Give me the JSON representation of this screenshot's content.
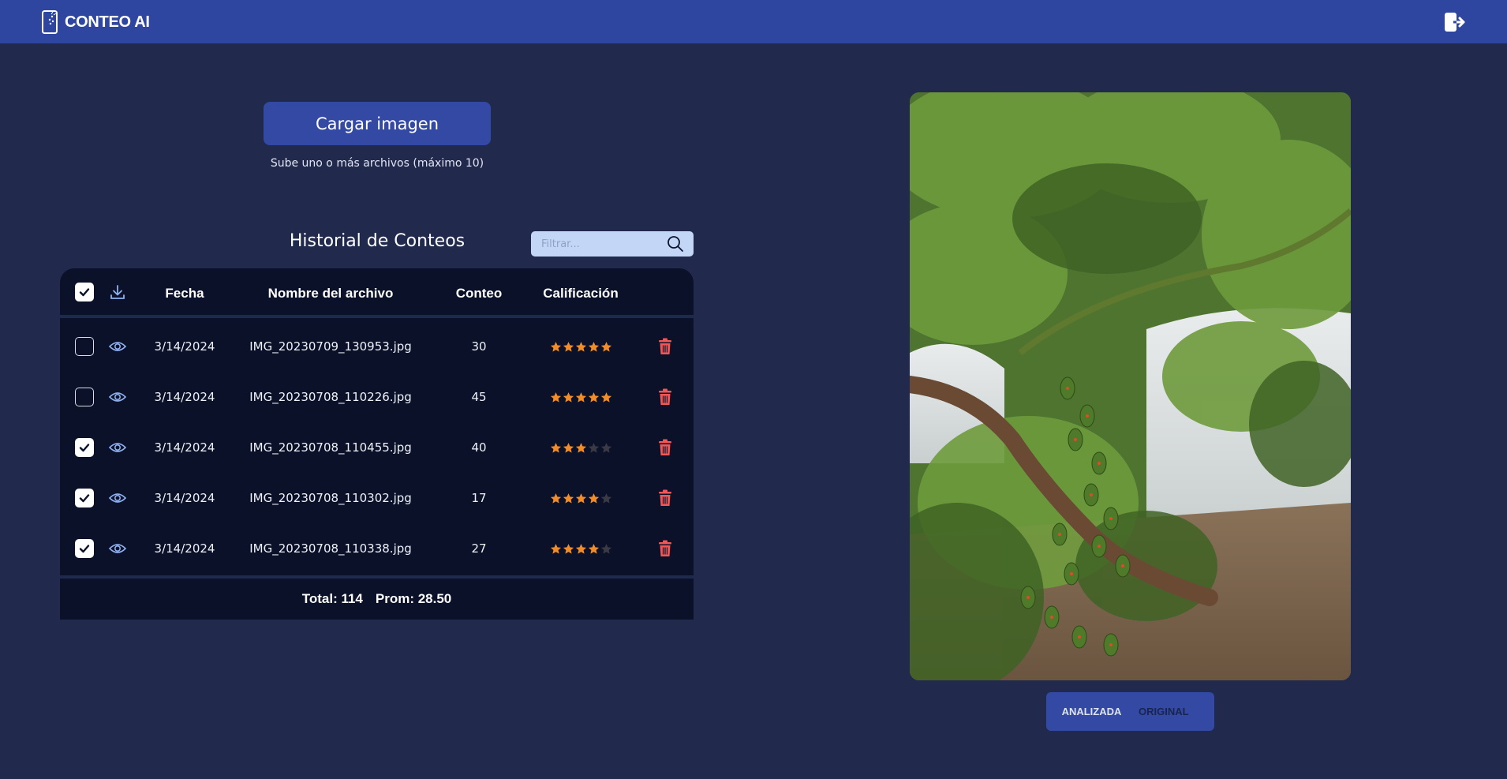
{
  "app": {
    "brand": "CONTEO AI"
  },
  "upload": {
    "button_label": "Cargar imagen",
    "hint": "Sube uno o más archivos (máximo 10)"
  },
  "history": {
    "title": "Historial de Conteos",
    "filter_placeholder": "Filtrar...",
    "columns": {
      "date": "Fecha",
      "filename": "Nombre del archivo",
      "count": "Conteo",
      "rating": "Calificación"
    },
    "select_all_checked": true,
    "rows": [
      {
        "checked": false,
        "date": "3/14/2024",
        "filename": "IMG_20230709_130953.jpg",
        "count": "30",
        "rating": 5
      },
      {
        "checked": false,
        "date": "3/14/2024",
        "filename": "IMG_20230708_110226.jpg",
        "count": "45",
        "rating": 5
      },
      {
        "checked": true,
        "date": "3/14/2024",
        "filename": "IMG_20230708_110455.jpg",
        "count": "40",
        "rating": 3
      },
      {
        "checked": true,
        "date": "3/14/2024",
        "filename": "IMG_20230708_110302.jpg",
        "count": "17",
        "rating": 4
      },
      {
        "checked": true,
        "date": "3/14/2024",
        "filename": "IMG_20230708_110338.jpg",
        "count": "27",
        "rating": 4
      }
    ],
    "footer": {
      "total": "Total: 114",
      "average": "Prom: 28.50"
    }
  },
  "viewer": {
    "tabs": {
      "analyzed": "ANALIZADA",
      "original": "ORIGINAL"
    },
    "active_tab": "analyzed"
  },
  "colors": {
    "topbar": "#2e46a0",
    "background": "#212a4d",
    "table": "#0a1129",
    "star_on": "#f28c28",
    "star_off": "#3a3a44",
    "trash": "#f25757",
    "eye": "#8fb0ee",
    "download": "#8fb0ee"
  },
  "icons": [
    "phone-scan-icon",
    "logout-icon",
    "search-icon",
    "download-icon",
    "eye-icon",
    "star-icon",
    "trash-icon",
    "check-icon"
  ]
}
